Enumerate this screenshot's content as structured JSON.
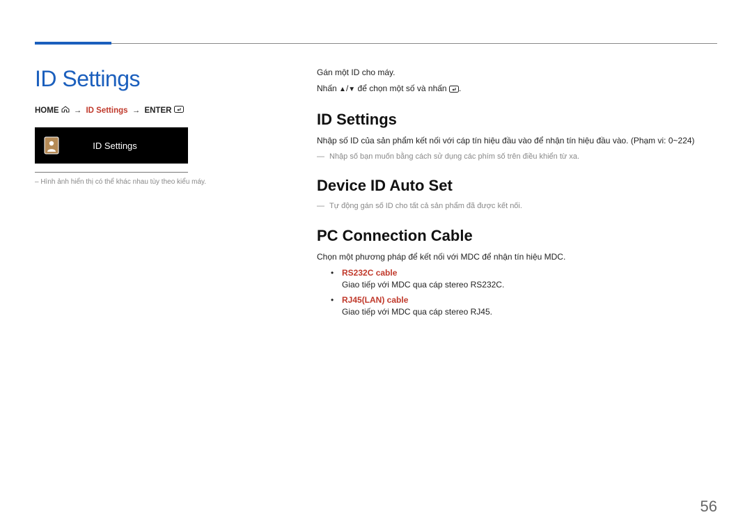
{
  "left": {
    "title": "ID Settings",
    "breadcrumb": {
      "home": "HOME",
      "current": "ID Settings",
      "enter": "ENTER"
    },
    "menu_label": "ID Settings",
    "note": "– Hình ảnh hiển thị có thể khác nhau tùy theo kiểu máy."
  },
  "right": {
    "intro1": "Gán một ID cho máy.",
    "intro2_a": "Nhấn ",
    "intro2_b": " để chọn một số và nhấn ",
    "intro2_c": ".",
    "section1": {
      "title": "ID Settings",
      "body": "Nhập số ID của sản phẩm kết nối với cáp tín hiệu đầu vào để nhận tín hiệu đầu vào. (Phạm vi: 0~224)",
      "dash": "Nhập số bạn muốn bằng cách sử dụng các phím số trên điều khiển từ xa."
    },
    "section2": {
      "title": "Device ID Auto Set",
      "dash": "Tự động gán số ID cho tất cả sản phẩm đã được kết nối."
    },
    "section3": {
      "title": "PC Connection Cable",
      "body": "Chọn một phương pháp để kết nối với MDC để nhận tín hiệu MDC.",
      "bullets": [
        {
          "title": "RS232C cable",
          "desc": "Giao tiếp với MDC qua cáp stereo RS232C."
        },
        {
          "title": "RJ45(LAN) cable",
          "desc": "Giao tiếp với MDC qua cáp stereo RJ45."
        }
      ]
    }
  },
  "page_number": "56"
}
